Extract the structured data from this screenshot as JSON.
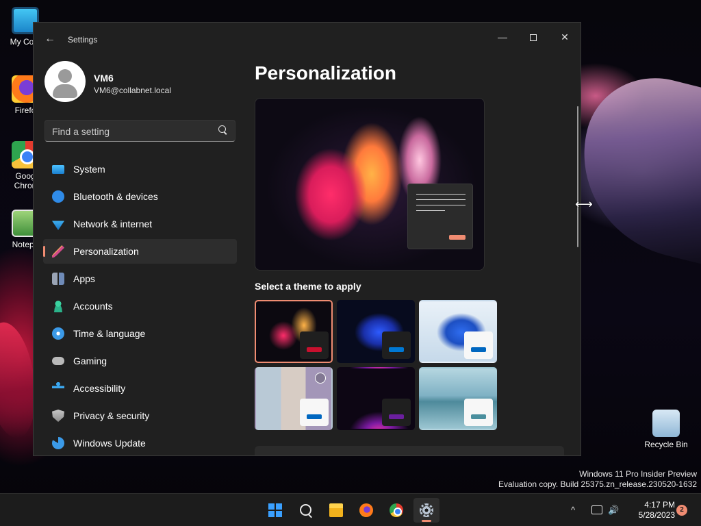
{
  "desktop": {
    "icons": [
      {
        "label": "My Com",
        "icon": "computer-icon"
      },
      {
        "label": "Firefo",
        "icon": "firefox-icon"
      },
      {
        "label": "Goog",
        "label2": "Chron",
        "icon": "chrome-icon"
      },
      {
        "label": "Notepa",
        "icon": "notepad-icon"
      },
      {
        "label": "Recycle Bin",
        "icon": "recycle-bin-icon"
      }
    ],
    "watermark": {
      "line1": "Windows 11 Pro Insider Preview",
      "line2": "Evaluation copy. Build 25375.zn_release.230520-1632"
    }
  },
  "window": {
    "title": "Settings",
    "controls": {
      "minimize": "—",
      "close": "✕"
    },
    "back_glyph": "←"
  },
  "user": {
    "name": "VM6",
    "email": "VM6@collabnet.local"
  },
  "search": {
    "placeholder": "Find a setting"
  },
  "nav": {
    "items": [
      {
        "label": "System",
        "icon": "system-icon"
      },
      {
        "label": "Bluetooth & devices",
        "icon": "bluetooth-icon"
      },
      {
        "label": "Network & internet",
        "icon": "network-icon"
      },
      {
        "label": "Personalization",
        "icon": "personalization-icon",
        "selected": true
      },
      {
        "label": "Apps",
        "icon": "apps-icon"
      },
      {
        "label": "Accounts",
        "icon": "accounts-icon"
      },
      {
        "label": "Time & language",
        "icon": "time-language-icon"
      },
      {
        "label": "Gaming",
        "icon": "gaming-icon"
      },
      {
        "label": "Accessibility",
        "icon": "accessibility-icon"
      },
      {
        "label": "Privacy & security",
        "icon": "privacy-icon"
      },
      {
        "label": "Windows Update",
        "icon": "windows-update-icon"
      }
    ]
  },
  "content": {
    "title": "Personalization",
    "themes_heading": "Select a theme to apply",
    "themes": [
      {
        "id": "glow-dark",
        "selected": true,
        "accent": "#c8102e",
        "mode": "dark"
      },
      {
        "id": "bloom-dark",
        "selected": false,
        "accent": "#0078d4",
        "mode": "dark"
      },
      {
        "id": "bloom-light",
        "selected": false,
        "accent": "#0067c0",
        "mode": "light"
      },
      {
        "id": "spotlight",
        "selected": false,
        "accent": "#0067c0",
        "mode": "light"
      },
      {
        "id": "captured-motion",
        "selected": false,
        "accent": "#6b1f9e",
        "mode": "dark"
      },
      {
        "id": "flow",
        "selected": false,
        "accent": "#4a8f9e",
        "mode": "light"
      }
    ]
  },
  "taskbar": {
    "apps": [
      {
        "name": "start-icon"
      },
      {
        "name": "search-icon"
      },
      {
        "name": "file-explorer-icon"
      },
      {
        "name": "firefox-icon"
      },
      {
        "name": "chrome-icon"
      },
      {
        "name": "settings-icon",
        "active": true
      }
    ],
    "tray": {
      "chevron": "^",
      "volume": "🔊",
      "time": "4:17 PM",
      "date": "5/28/2023",
      "notifications": "2"
    }
  },
  "colors": {
    "accent": "#f08c72",
    "window_bg": "#202020",
    "taskbar_bg": "#1c1c1c"
  }
}
